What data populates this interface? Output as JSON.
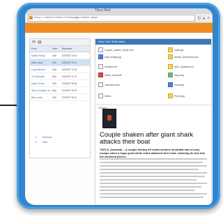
{
  "browser": {
    "window_title": "Tibco Mail",
    "url": "http://mailclient/frontpage/index.aspx"
  },
  "list": {
    "columns": [
      "From",
      "Size",
      "Received"
    ],
    "rows": [
      {
        "from": "Martin Hong",
        "size": "4kb",
        "received": "3/3/2007 9:54"
      },
      {
        "from": "Meg Lang",
        "size": "6kb",
        "received": "3/3/2007 9:41"
      },
      {
        "from": "Lucy Barnes",
        "size": "2kb",
        "received": "3/3/2007 9:30"
      },
      {
        "from": "Jo Chandler",
        "size": "5kb",
        "received": "3/3/2007 9:12"
      },
      {
        "from": "Mark Turner",
        "size": "3kb",
        "received": "3/3/2007 8:55"
      },
      {
        "from": "Simon Knight Ltd",
        "size": "8kb",
        "received": "3/3/2007 8:40"
      },
      {
        "from": "Ben Lowe",
        "size": "2kb",
        "received": "3/3/2007 8:21"
      }
    ],
    "pager": [
      {
        "num": "1",
        "label": "Previous"
      },
      {
        "num": "2",
        "label": "Next"
      }
    ]
  },
  "detail": {
    "header": "Inbox: Fwd: Shark attack",
    "attachments": [
      "Couple_shaken_shark.htm",
      "shark.gif",
      "boat_image.jpg",
      "Article_comments.doc",
      "Readme.txt",
      "ABC_Australia.url",
      "Shark_facts.pdf",
      "Map.png",
      "Tasmania.htm",
      "summary",
      "Notes",
      "Photo.jpg"
    ],
    "preview_label": "Preview",
    "headline": "Couple shaken after giant shark attacks their boat",
    "lead": "TUFLS, Australia -- A couple fishing off south-western Australia had a lucky escape when a huge great white shark attacked their boat, ramming its hull into the weekend pieces."
  },
  "colors": {
    "device_frame": "#2f86cf",
    "accent_bar": "#f08c1f",
    "selection": "#cfe2f6"
  }
}
